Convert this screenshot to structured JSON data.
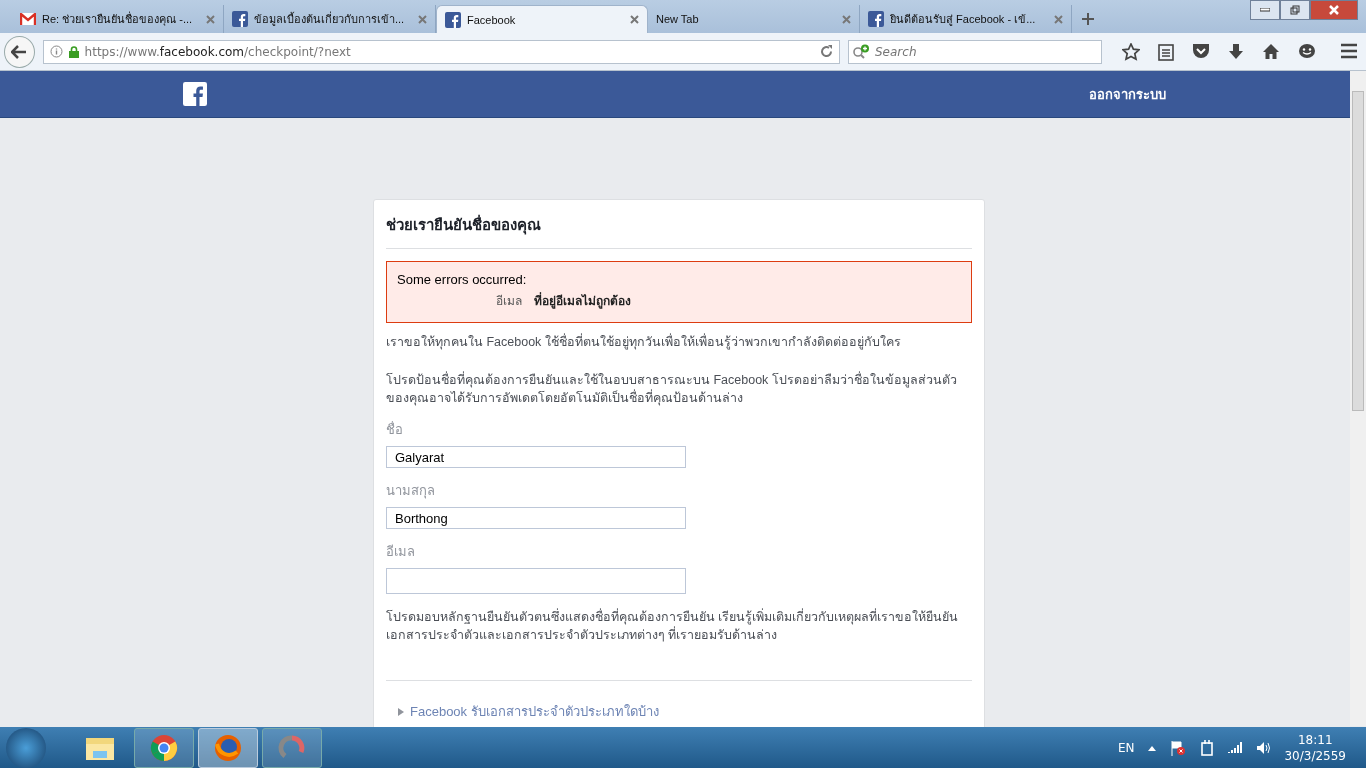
{
  "browser": {
    "tabs": [
      {
        "title": "Re: ช่วยเรายืนยันชื่อของคุณ -...",
        "kind": "mail",
        "selected": false
      },
      {
        "title": "ข้อมูลเบื้องต้นเกี่ยวกับการเข้า...",
        "kind": "site",
        "selected": false
      },
      {
        "title": "Facebook",
        "kind": "site",
        "selected": true
      },
      {
        "title": "New Tab",
        "kind": "blank",
        "selected": false
      },
      {
        "title": "ยินดีต้อนรับสู่ Facebook - เข้...",
        "kind": "site",
        "selected": false
      }
    ],
    "url": {
      "prefix": "https://www.",
      "domain": "facebook.com",
      "path": "/checkpoint/?next"
    },
    "search": {
      "placeholder": "Search"
    }
  },
  "header": {
    "logout": "ออกจากระบบ"
  },
  "card": {
    "title": "ช่วยเรายืนยันชื่อของคุณ",
    "error": {
      "heading": "Some errors occurred:",
      "field": "อีเมล",
      "message": "ที่อยู่อีเมลไม่ถูกต้อง"
    },
    "paragraphs": [
      "เราขอให้ทุกคนใน Facebook ใช้ชื่อที่ตนใช้อยู่ทุกวันเพื่อให้เพื่อนรู้ว่าพวกเขากำลังติดต่ออยู่กับใคร",
      "โปรดป้อนชื่อที่คุณต้องการยืนยันและใช้ในอบบสาธารณะบน Facebook โปรดอย่าลืมว่าชื่อในข้อมูลส่วนตัวของคุณอาจได้รับการอัพเดตโดยอัตโนมัติเป็นชื่อที่คุณป้อนด้านล่าง"
    ],
    "fields": [
      {
        "label": "ชื่อ",
        "value": "Galyarat"
      },
      {
        "label": "นามสกุล",
        "value": "Borthong"
      },
      {
        "label": "อีเมล"
      }
    ],
    "note": "โปรดมอบหลักฐานยืนยันตัวตนซึ่งแสดงชื่อที่คุณต้องการยืนยัน เรียนรู้เพิ่มเติมเกี่ยวกับเหตุผลที่เราขอให้ยืนยันเอกสารประจำตัวและเอกสารประจำตัวประเภทต่างๆ ที่เรายอมรับด้านล่าง",
    "disclosure": {
      "label": "Facebook รับเอกสารประจำตัวประเภทใดบ้าง",
      "expanded": false
    }
  },
  "taskbar": {
    "apps": [
      {
        "kind": "folder",
        "selected": false
      },
      {
        "kind": "chrome",
        "selected": false
      },
      {
        "kind": "firefox",
        "selected": true
      },
      {
        "kind": "other",
        "selected": false
      }
    ],
    "language": "EN",
    "time": "18:11",
    "date": "30/3/2559"
  }
}
